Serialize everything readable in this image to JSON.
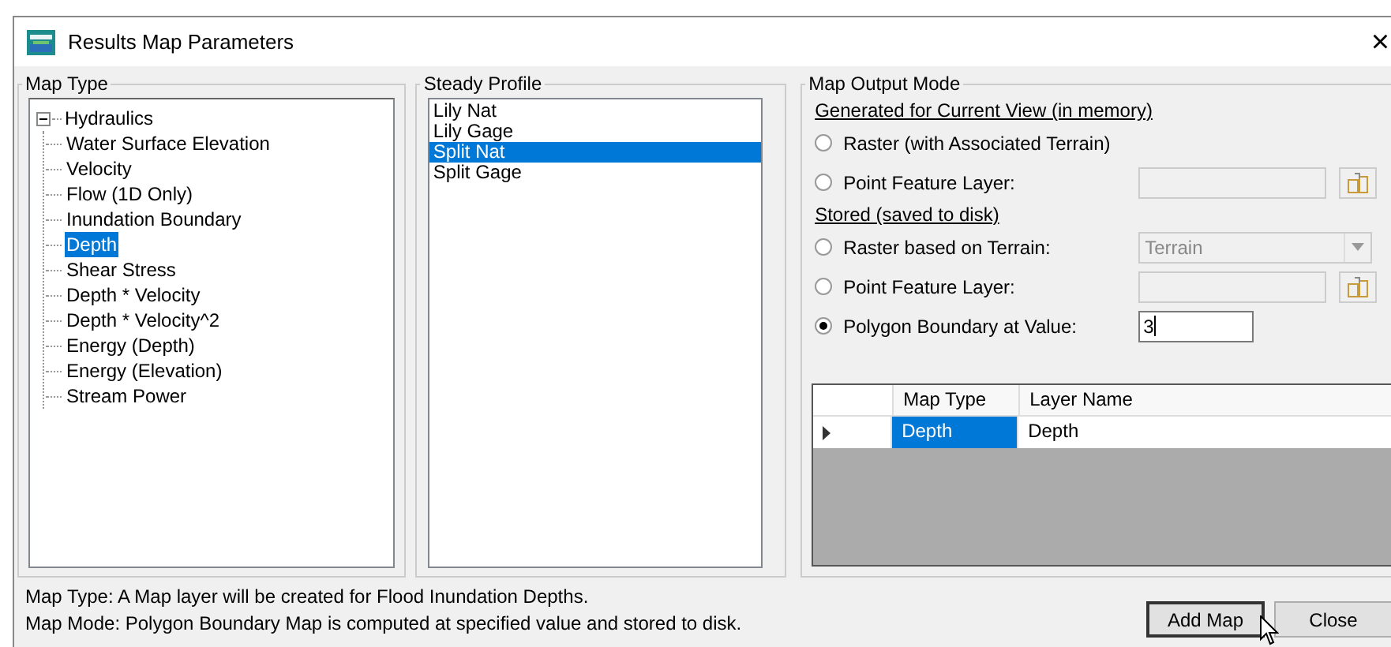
{
  "window": {
    "title": "Results Map Parameters",
    "close_glyph": "×"
  },
  "map_type": {
    "title": "Map Type",
    "tree": [
      {
        "label": "Hydraulics",
        "expanded": true,
        "selected": false,
        "children": [
          {
            "label": "Water Surface Elevation",
            "selected": false
          },
          {
            "label": "Velocity",
            "selected": false
          },
          {
            "label": "Flow (1D Only)",
            "selected": false
          },
          {
            "label": "Inundation Boundary",
            "selected": false
          },
          {
            "label": "Depth",
            "selected": true
          },
          {
            "label": "Shear Stress",
            "selected": false
          },
          {
            "label": "Depth * Velocity",
            "selected": false
          },
          {
            "label": "Depth * Velocity^2",
            "selected": false
          },
          {
            "label": "Energy (Depth)",
            "selected": false
          },
          {
            "label": "Energy (Elevation)",
            "selected": false
          },
          {
            "label": "Stream Power",
            "selected": false
          }
        ]
      }
    ]
  },
  "steady_profile": {
    "title": "Steady Profile",
    "items": [
      {
        "label": "Lily Nat",
        "selected": false
      },
      {
        "label": "Lily Gage",
        "selected": false
      },
      {
        "label": "Split Nat",
        "selected": true
      },
      {
        "label": "Split Gage",
        "selected": false
      }
    ]
  },
  "map_output_mode": {
    "title": "Map Output Mode",
    "sections": [
      {
        "heading": "Generated for Current View (in memory)",
        "options": [
          {
            "label": "Raster (with Associated Terrain)",
            "selected": false
          },
          {
            "label": "Point Feature Layer:",
            "selected": false,
            "field": {
              "kind": "browse",
              "disabled": true
            }
          }
        ]
      },
      {
        "heading": "Stored (saved to disk)",
        "options": [
          {
            "label": "Raster based on Terrain:",
            "selected": false,
            "field": {
              "kind": "dropdown",
              "value": "Terrain",
              "disabled": true
            }
          },
          {
            "label": "Point Feature Layer:",
            "selected": false,
            "field": {
              "kind": "browse",
              "disabled": true
            }
          },
          {
            "label": "Polygon Boundary at Value:",
            "selected": true,
            "field": {
              "kind": "text",
              "value": "3",
              "disabled": false
            }
          }
        ]
      }
    ]
  },
  "grid": {
    "columns": [
      "Map Type",
      "Layer Name"
    ],
    "rows": [
      {
        "current": true,
        "cells": [
          {
            "text": "Depth",
            "selected": true
          },
          {
            "text": "Depth",
            "selected": false
          }
        ]
      }
    ]
  },
  "status_lines": [
    "Map Type: A Map layer will be created for Flood Inundation Depths.",
    "Map Mode: Polygon Boundary Map is computed at specified value and stored to disk."
  ],
  "buttons": [
    {
      "label": "Add Map",
      "default": true
    },
    {
      "label": "Close",
      "default": false
    }
  ]
}
